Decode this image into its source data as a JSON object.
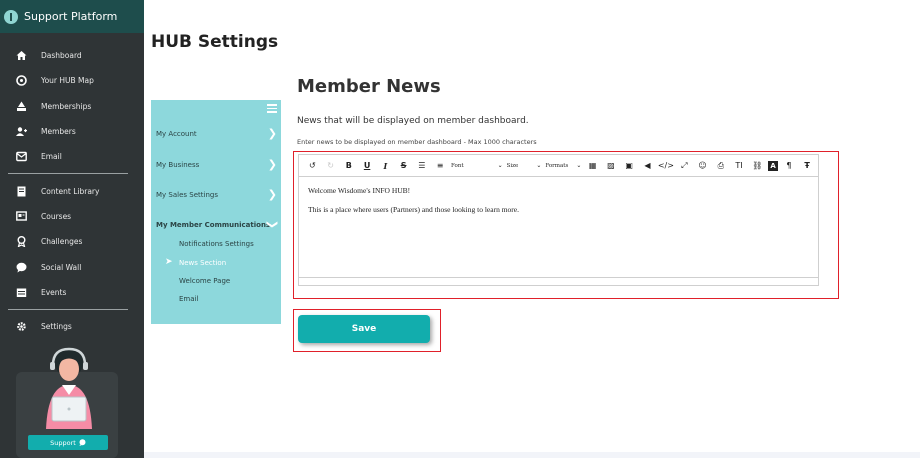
{
  "app": {
    "title": "Support Platform"
  },
  "sidebar": {
    "items": [
      {
        "label": "Dashboard",
        "icon": "home-icon"
      },
      {
        "label": "Your HUB Map",
        "icon": "map-icon"
      },
      {
        "label": "Memberships",
        "icon": "memberships-icon"
      },
      {
        "label": "Members",
        "icon": "members-icon"
      },
      {
        "label": "Email",
        "icon": "email-icon"
      },
      {
        "label": "Content Library",
        "icon": "library-icon"
      },
      {
        "label": "Courses",
        "icon": "courses-icon"
      },
      {
        "label": "Challenges",
        "icon": "challenges-icon"
      },
      {
        "label": "Social Wall",
        "icon": "social-icon"
      },
      {
        "label": "Events",
        "icon": "events-icon"
      },
      {
        "label": "Settings",
        "icon": "gear-icon"
      }
    ],
    "support_label": "Support"
  },
  "page": {
    "title": "HUB Settings"
  },
  "settings_menu": {
    "items": [
      {
        "label": "My Account"
      },
      {
        "label": "My Business"
      },
      {
        "label": "My Sales Settings"
      },
      {
        "label": "My Member Communications"
      }
    ],
    "sub_items": [
      {
        "label": "Notifications Settings"
      },
      {
        "label": "News Section"
      },
      {
        "label": "Welcome Page"
      },
      {
        "label": "Email"
      }
    ]
  },
  "section": {
    "title": "Member News",
    "description": "News that will be displayed on member dashboard.",
    "hint": "Enter news to be displayed on member dashboard - Max 1000 characters"
  },
  "editor": {
    "font_label": "Font",
    "size_label": "Size",
    "formats_label": "Formats",
    "lines": [
      "Welcome Wisdome's INFO HUB!",
      "This is a place where users (Partners) and those looking to learn more."
    ]
  },
  "save_label": "Save",
  "colors": {
    "sidebar_bg": "#2f3436",
    "brand_bg": "#1e4d4c",
    "panel_bg": "#8dd8dc",
    "accent": "#12adad",
    "highlight_border": "#e0202a"
  }
}
